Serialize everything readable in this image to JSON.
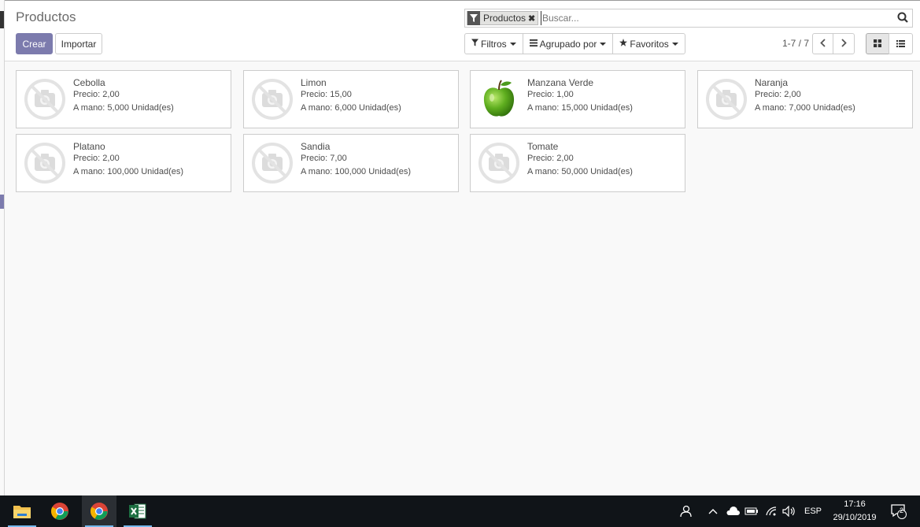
{
  "header": {
    "title": "Productos",
    "create_label": "Crear",
    "import_label": "Importar"
  },
  "search": {
    "facet_label": "Productos",
    "facet_remove": "✖",
    "placeholder": "Buscar..."
  },
  "filters": {
    "filters_label": "Filtros",
    "group_by_label": "Agrupado por",
    "favorites_label": "Favoritos"
  },
  "pager": {
    "value": "1-7 / 7"
  },
  "products": [
    {
      "name": "Cebolla",
      "price": "Precio: 2,00",
      "onhand": "A mano: 5,000 Unidad(es)",
      "image": "placeholder"
    },
    {
      "name": "Limon",
      "price": "Precio: 15,00",
      "onhand": "A mano: 6,000 Unidad(es)",
      "image": "placeholder"
    },
    {
      "name": "Manzana Verde",
      "price": "Precio: 1,00",
      "onhand": "A mano: 15,000 Unidad(es)",
      "image": "green-apple"
    },
    {
      "name": "Naranja",
      "price": "Precio: 2,00",
      "onhand": "A mano: 7,000 Unidad(es)",
      "image": "placeholder"
    },
    {
      "name": "Platano",
      "price": "Precio: 2,00",
      "onhand": "A mano: 100,000 Unidad(es)",
      "image": "placeholder"
    },
    {
      "name": "Sandia",
      "price": "Precio: 7,00",
      "onhand": "A mano: 100,000 Unidad(es)",
      "image": "placeholder"
    },
    {
      "name": "Tomate",
      "price": "Precio: 2,00",
      "onhand": "A mano: 50,000 Unidad(es)",
      "image": "placeholder"
    }
  ],
  "taskbar": {
    "apps": [
      "file-explorer-icon",
      "chrome-icon",
      "chrome-icon",
      "excel-icon"
    ],
    "language": "ESP",
    "time": "17:16",
    "date": "29/10/2019",
    "notifications": "2"
  },
  "colors": {
    "primary": "#7c7bad",
    "taskbar": "#101418"
  }
}
